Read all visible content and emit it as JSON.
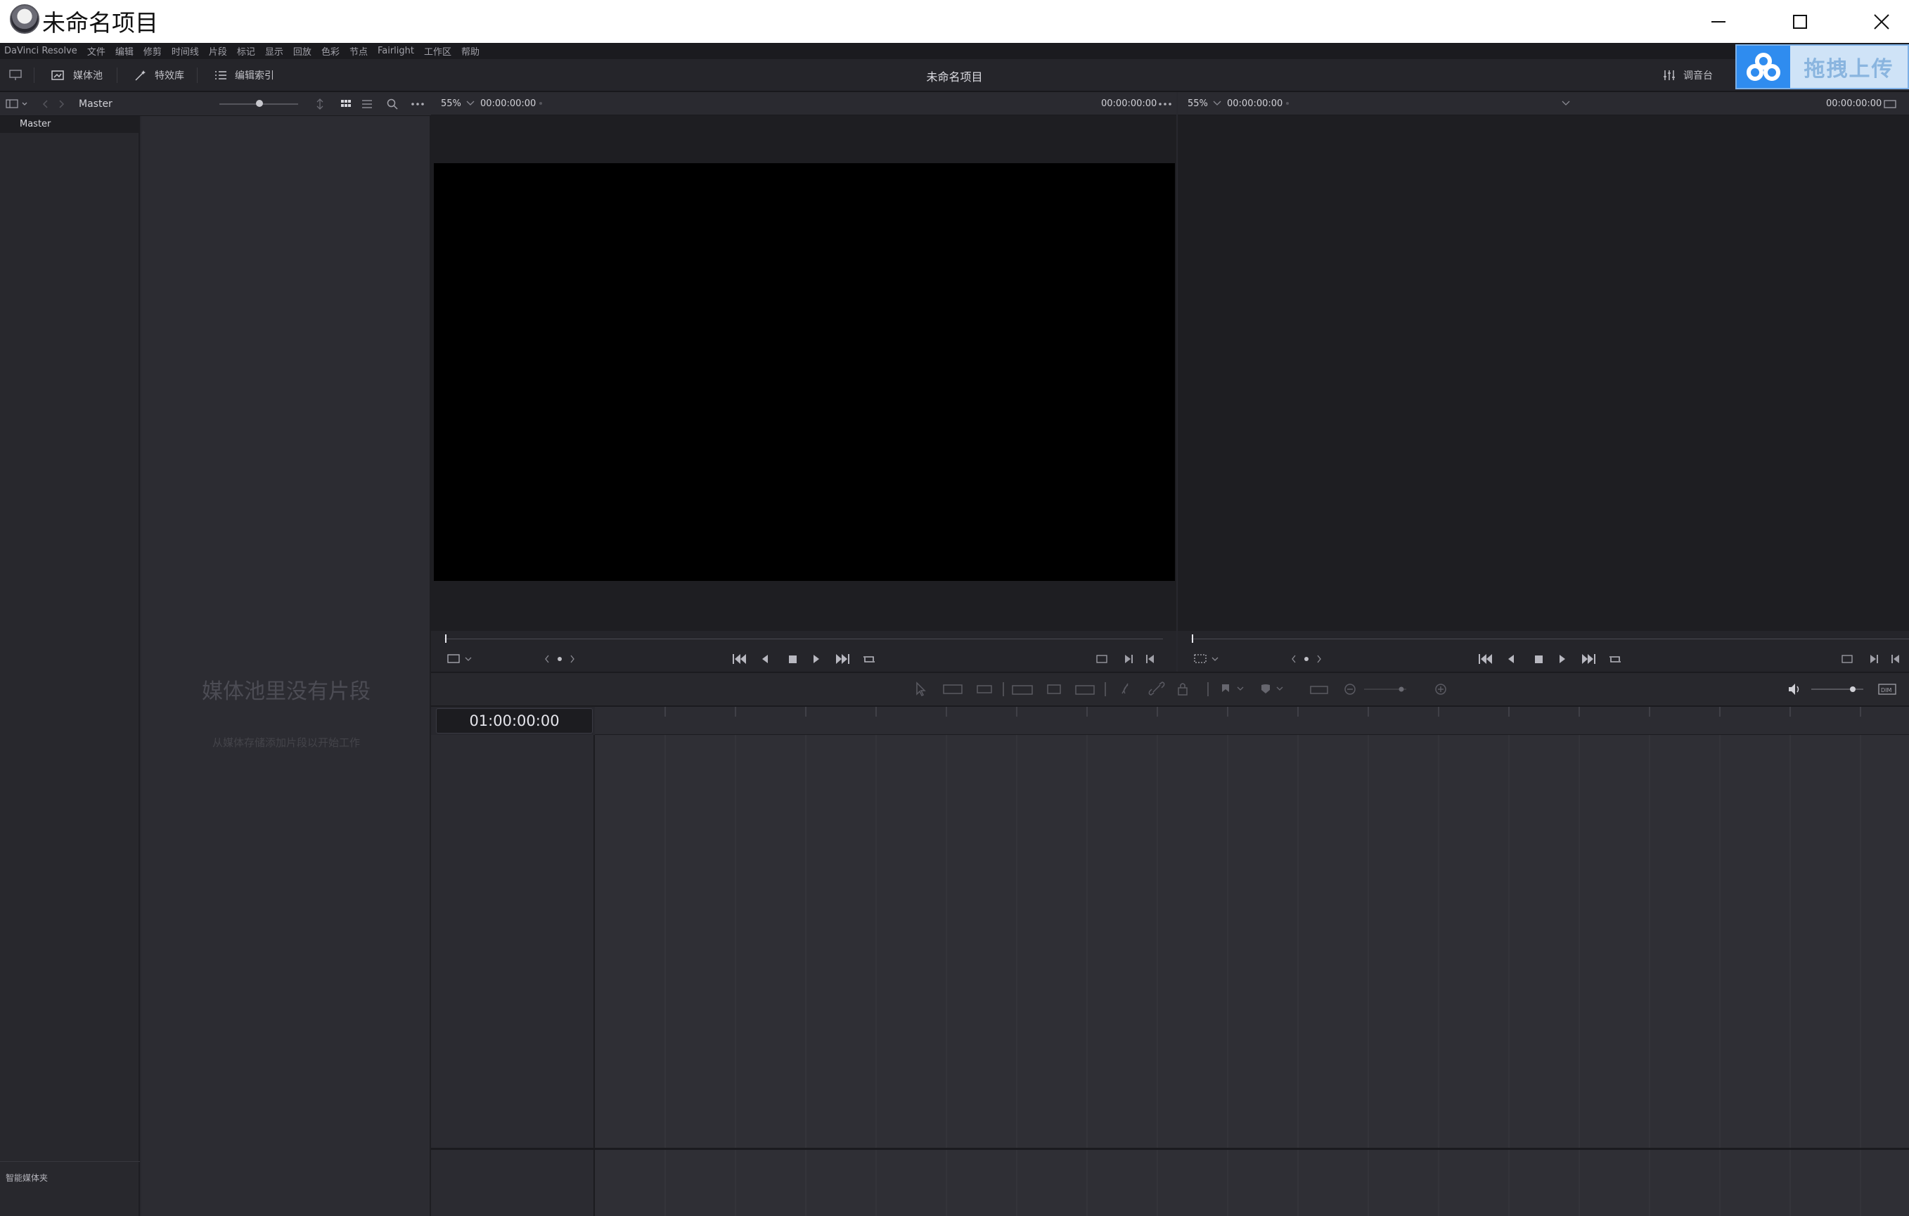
{
  "window": {
    "title": "未命名项目",
    "controls": [
      "minimize-icon",
      "maximize-icon",
      "close-icon"
    ]
  },
  "menu": [
    "DaVinci Resolve",
    "文件",
    "编辑",
    "修剪",
    "时间线",
    "片段",
    "标记",
    "显示",
    "回放",
    "色彩",
    "节点",
    "Fairlight",
    "工作区",
    "帮助"
  ],
  "toolbar": {
    "media_pool": "媒体池",
    "effects": "特效库",
    "edit_index": "编辑索引",
    "project_title": "未命名项目",
    "mixer": "调音台"
  },
  "upload_badge": {
    "label": "拖拽上传"
  },
  "media_pool": {
    "breadcrumb": "Master",
    "bins": [
      "Master"
    ],
    "smart_bins_label": "智能媒体夹",
    "empty_title": "媒体池里没有片段",
    "empty_subtitle": "从媒体存储添加片段以开始工作"
  },
  "source_viewer": {
    "zoom": "55%",
    "timecode_left": "00:00:00:00",
    "timecode_right": "00:00:00:00"
  },
  "timeline_viewer": {
    "zoom": "55%",
    "timecode_left": "00:00:00:00",
    "timecode_right": "00:00:00:00"
  },
  "timeline": {
    "timecode": "01:00:00:00"
  },
  "colors": {
    "accent_upload": "#2f8cef",
    "panel_bg": "#28282d",
    "viewer_bg": "#1e1e22"
  }
}
